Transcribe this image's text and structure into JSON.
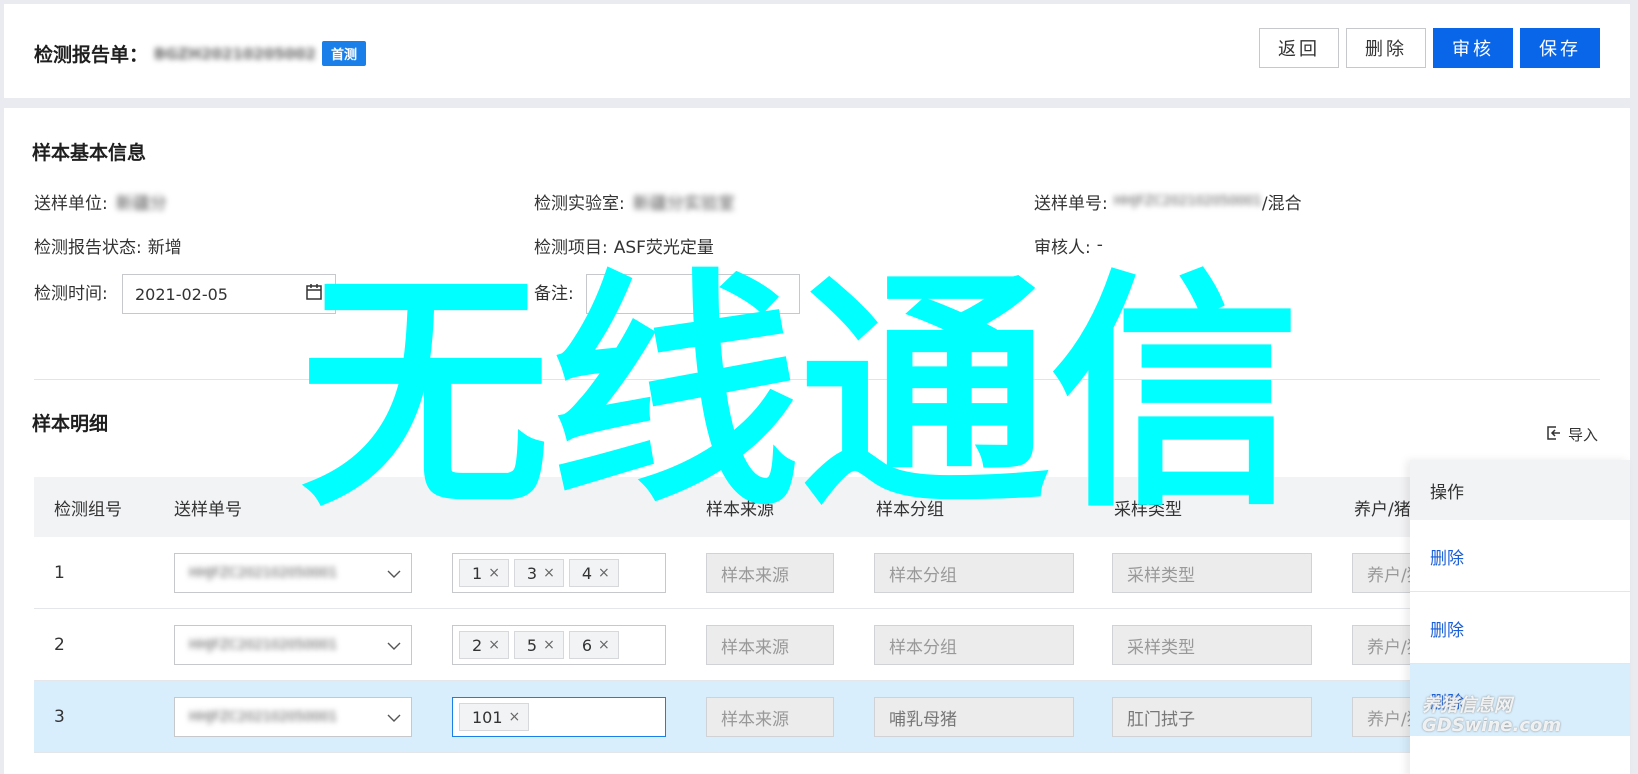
{
  "header": {
    "title_label": "检测报告单：",
    "report_no": "BGZH20210205002",
    "badge": "首测",
    "buttons": {
      "back": "返回",
      "delete": "删除",
      "review": "审核",
      "save": "保存"
    }
  },
  "basic_info": {
    "section_title": "样本基本信息",
    "sender_unit_label": "送样单位:",
    "sender_unit_value": "新疆分",
    "lab_label": "检测实验室:",
    "lab_value": "新疆分实验室",
    "sample_no_label": "送样单号:",
    "sample_no_value": "HHJFZC202102050001",
    "sample_no_suffix": "/混合",
    "status_label": "检测报告状态:",
    "status_value": "新增",
    "item_label": "检测项目:",
    "item_value": "ASF荧光定量",
    "reviewer_label": "审核人:",
    "reviewer_value": "-",
    "time_label": "检测时间:",
    "time_value": "2021-02-05",
    "remark_label": "备注:",
    "remark_value": ""
  },
  "detail": {
    "section_title": "样本明细",
    "import_label": "导入",
    "columns": [
      "检测组号",
      "送样单号",
      "",
      "样本来源",
      "样本分组",
      "采样类型",
      "养户/猪场",
      "操作"
    ],
    "rows": [
      {
        "group_no": "1",
        "sample_no": "HHJFZC202102050001",
        "tags": [
          "1",
          "3",
          "4"
        ],
        "source": "样本来源",
        "group": "样本分组",
        "sample_type": "采样类型",
        "farm": "养户/猪场",
        "action": "删除"
      },
      {
        "group_no": "2",
        "sample_no": "HHJFZC202102050001",
        "tags": [
          "2",
          "5",
          "6"
        ],
        "source": "样本来源",
        "group": "样本分组",
        "sample_type": "采样类型",
        "farm": "养户/猪场",
        "action": "删除"
      },
      {
        "group_no": "3",
        "sample_no": "HHJFZC202102050001",
        "tags": [
          "101"
        ],
        "source": "样本来源",
        "group": "哺乳母猪",
        "sample_type": "肛门拭子",
        "farm": "养户/猪场",
        "action": "删除"
      }
    ],
    "tag_close": "×"
  },
  "overlay": {
    "watermark": "无线通信",
    "corner_cn": "养猪信息网",
    "corner_en": "GDSwine.com"
  },
  "icons": {
    "calendar": "calendar-icon",
    "chevron": "chevron-down-icon",
    "import": "import-icon"
  },
  "colors": {
    "primary": "#0a66e8",
    "badge": "#1a7fe8",
    "watermark": "#00ffff",
    "selected_row": "#d8eefc",
    "link": "#1a5fd8"
  }
}
